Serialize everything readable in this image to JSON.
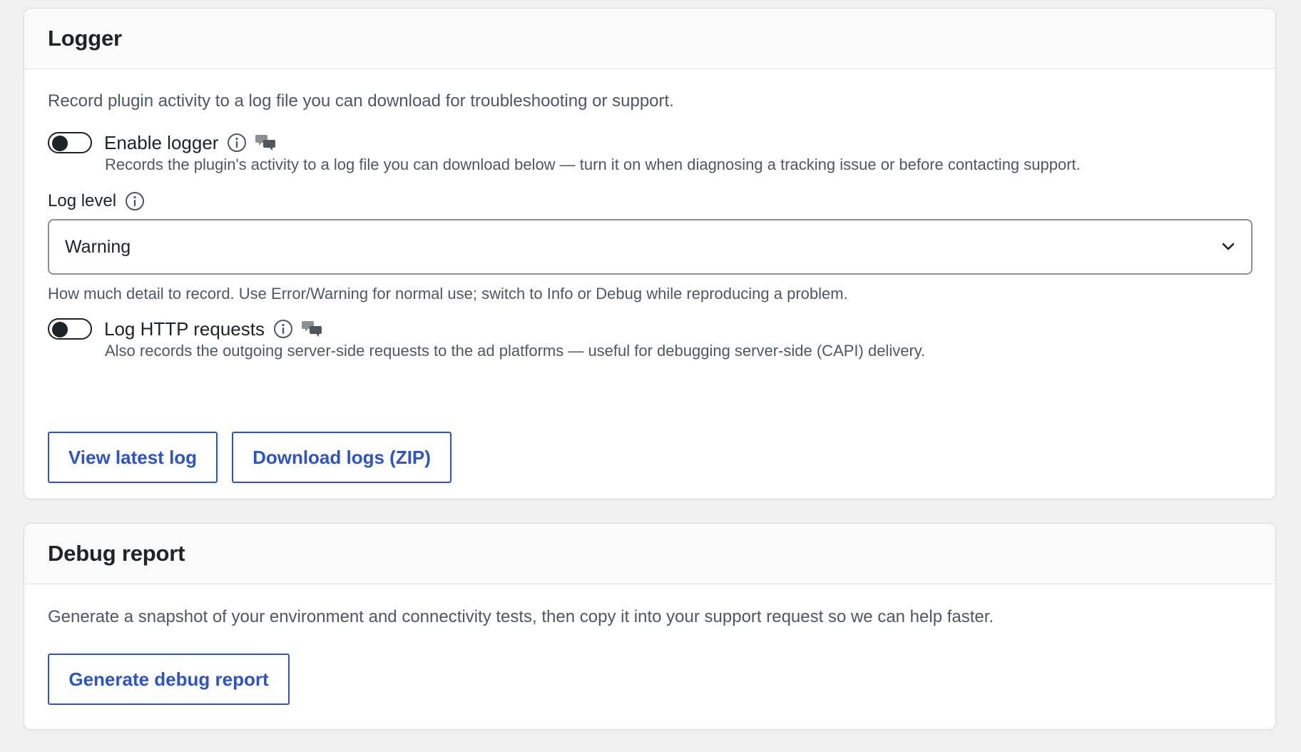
{
  "colors": {
    "accent": "#2c53c9",
    "text": "#1d2327",
    "muted": "#50575e",
    "page_bg": "#f0f0f1"
  },
  "logger": {
    "title": "Logger",
    "description": "Record plugin activity to a log file you can download for troubleshooting or support.",
    "enable_logger": {
      "label": "Enable logger",
      "enabled": false,
      "help": "Records the plugin's activity to a log file you can download below — turn it on when diagnosing a tracking issue or before contacting support.",
      "icons": [
        "info-icon",
        "chat-icon"
      ]
    },
    "log_level": {
      "label": "Log level",
      "selected": "Warning",
      "help": "How much detail to record. Use Error/Warning for normal use; switch to Info or Debug while reproducing a problem."
    },
    "log_http": {
      "label": "Log HTTP requests",
      "enabled": false,
      "help": "Also records the outgoing server-side requests to the ad platforms — useful for debugging server-side (CAPI) delivery.",
      "icons": [
        "info-icon",
        "chat-icon"
      ]
    },
    "buttons": {
      "view_latest": "View latest log",
      "download_zip": "Download logs (ZIP)"
    }
  },
  "debug_report": {
    "title": "Debug report",
    "description": "Generate a snapshot of your environment and connectivity tests, then copy it into your support request so we can help faster.",
    "button": "Generate debug report"
  }
}
